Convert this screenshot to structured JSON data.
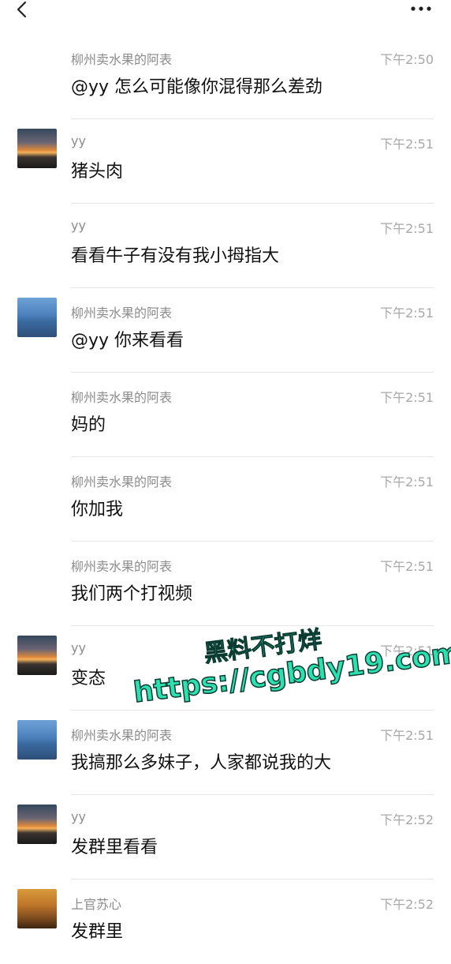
{
  "header": {
    "back_icon": "chevron-left-icon",
    "more_icon": "more-dots-icon"
  },
  "messages": [
    {
      "sender": "柳州卖水果的阿表",
      "time": "下午2:50",
      "text": "@yy 怎么可能像你混得那么差劲",
      "avatar": "none"
    },
    {
      "sender": "yy",
      "time": "下午2:51",
      "text": "猪头肉",
      "avatar": "sunset"
    },
    {
      "sender": "yy",
      "time": "下午2:51",
      "text": "看看牛子有没有我小拇指大",
      "avatar": "none"
    },
    {
      "sender": "柳州卖水果的阿表",
      "time": "下午2:51",
      "text": "@yy 你来看看",
      "avatar": "man"
    },
    {
      "sender": "柳州卖水果的阿表",
      "time": "下午2:51",
      "text": "妈的",
      "avatar": "none"
    },
    {
      "sender": "柳州卖水果的阿表",
      "time": "下午2:51",
      "text": "你加我",
      "avatar": "none"
    },
    {
      "sender": "柳州卖水果的阿表",
      "time": "下午2:51",
      "text": "我们两个打视频",
      "avatar": "none"
    },
    {
      "sender": "yy",
      "time": "下午2:51",
      "text": "变态",
      "avatar": "sunset"
    },
    {
      "sender": "柳州卖水果的阿表",
      "time": "下午2:51",
      "text": "我搞那么多妹子，人家都说我的大",
      "avatar": "man"
    },
    {
      "sender": "yy",
      "time": "下午2:52",
      "text": "发群里看看",
      "avatar": "sunset"
    },
    {
      "sender": "上官苏心",
      "time": "下午2:52",
      "text": "发群里",
      "avatar": "woman"
    }
  ],
  "watermark": {
    "line1": "黑料不打烊",
    "line2": "https://cgbdy19.com"
  },
  "colors": {
    "background": "#ffffff",
    "sender": "#8c8c8c",
    "time": "#a8a8a8",
    "text": "#111111",
    "divider": "#e6e6e6",
    "watermark": "#2de0b0"
  }
}
